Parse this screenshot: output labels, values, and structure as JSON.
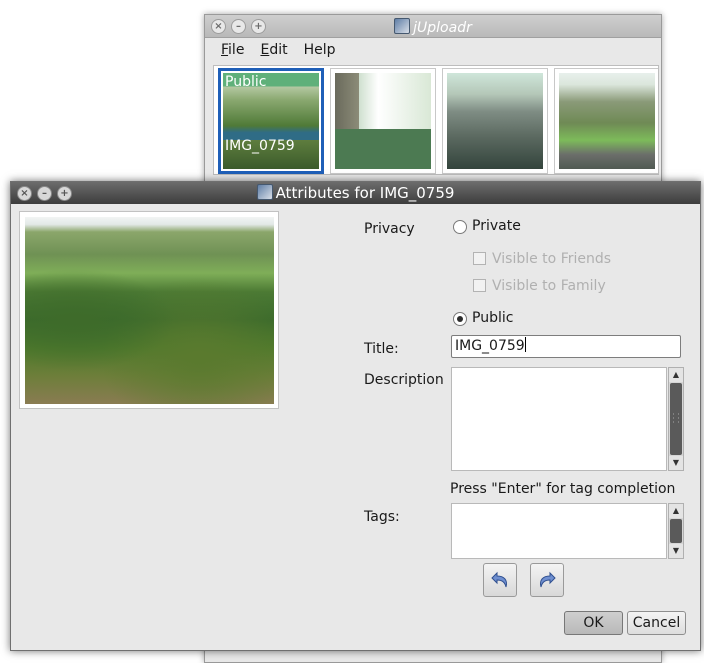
{
  "background_window": {
    "title": "jUploadr",
    "menu": [
      {
        "mnemonic": "F",
        "rest": "ile"
      },
      {
        "mnemonic": "E",
        "rest": "dit"
      },
      {
        "mnemonic": "",
        "rest": "Help"
      }
    ],
    "thumbnails": {
      "selected_privacy": "Public",
      "selected_title": "IMG_0759"
    }
  },
  "dialog": {
    "title": "Attributes for IMG_0759",
    "privacy": {
      "label": "Privacy",
      "private_label": "Private",
      "friends_label": "Visible to Friends",
      "family_label": "Visible to Family",
      "public_label": "Public",
      "selected": "Public"
    },
    "title_field": {
      "label": "Title:",
      "value": "IMG_0759"
    },
    "description": {
      "label": "Description",
      "value": ""
    },
    "tags": {
      "hint": "Press \"Enter\" for tag completion",
      "label": "Tags:",
      "value": ""
    },
    "buttons": {
      "ok": "OK",
      "cancel": "Cancel"
    },
    "icons": {
      "undo": "undo-icon",
      "redo": "redo-icon"
    },
    "colors": {
      "selection": "#1f5fb8",
      "titlebar": "#4a4a4a"
    }
  }
}
